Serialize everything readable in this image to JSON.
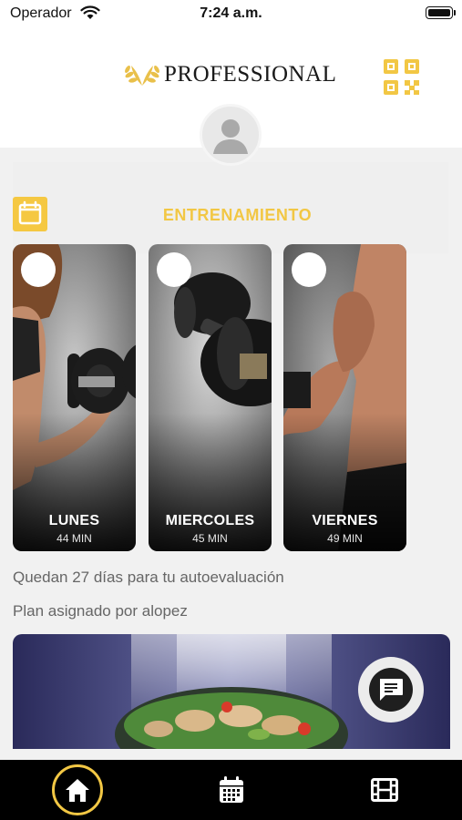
{
  "status_bar": {
    "carrier": "Operador",
    "time": "7:24 a.m."
  },
  "header": {
    "logo_text": "PROFESSIONAL",
    "qr_icon": "qr-code-icon",
    "avatar_icon": "user-avatar-icon"
  },
  "training": {
    "title": "ENTRENAMIENTO",
    "icon": "calendar-icon",
    "cards": [
      {
        "day": "LUNES",
        "duration": "44 MIN"
      },
      {
        "day": "MIERCOLES",
        "duration": "45 MIN"
      },
      {
        "day": "VIERNES",
        "duration": "49 MIN"
      }
    ]
  },
  "info": {
    "self_evaluation": "Quedan 27 días para tu autoevaluación",
    "assigned_by": "Plan asignado por alopez"
  },
  "chat": {
    "icon": "chat-icon"
  },
  "tab_bar": {
    "items": [
      {
        "icon": "home-icon",
        "active": true
      },
      {
        "icon": "calendar-grid-icon",
        "active": false
      },
      {
        "icon": "film-icon",
        "active": false
      }
    ]
  },
  "colors": {
    "accent": "#f2c744",
    "tab_bar": "#000000",
    "panel": "#f1f1f1"
  }
}
